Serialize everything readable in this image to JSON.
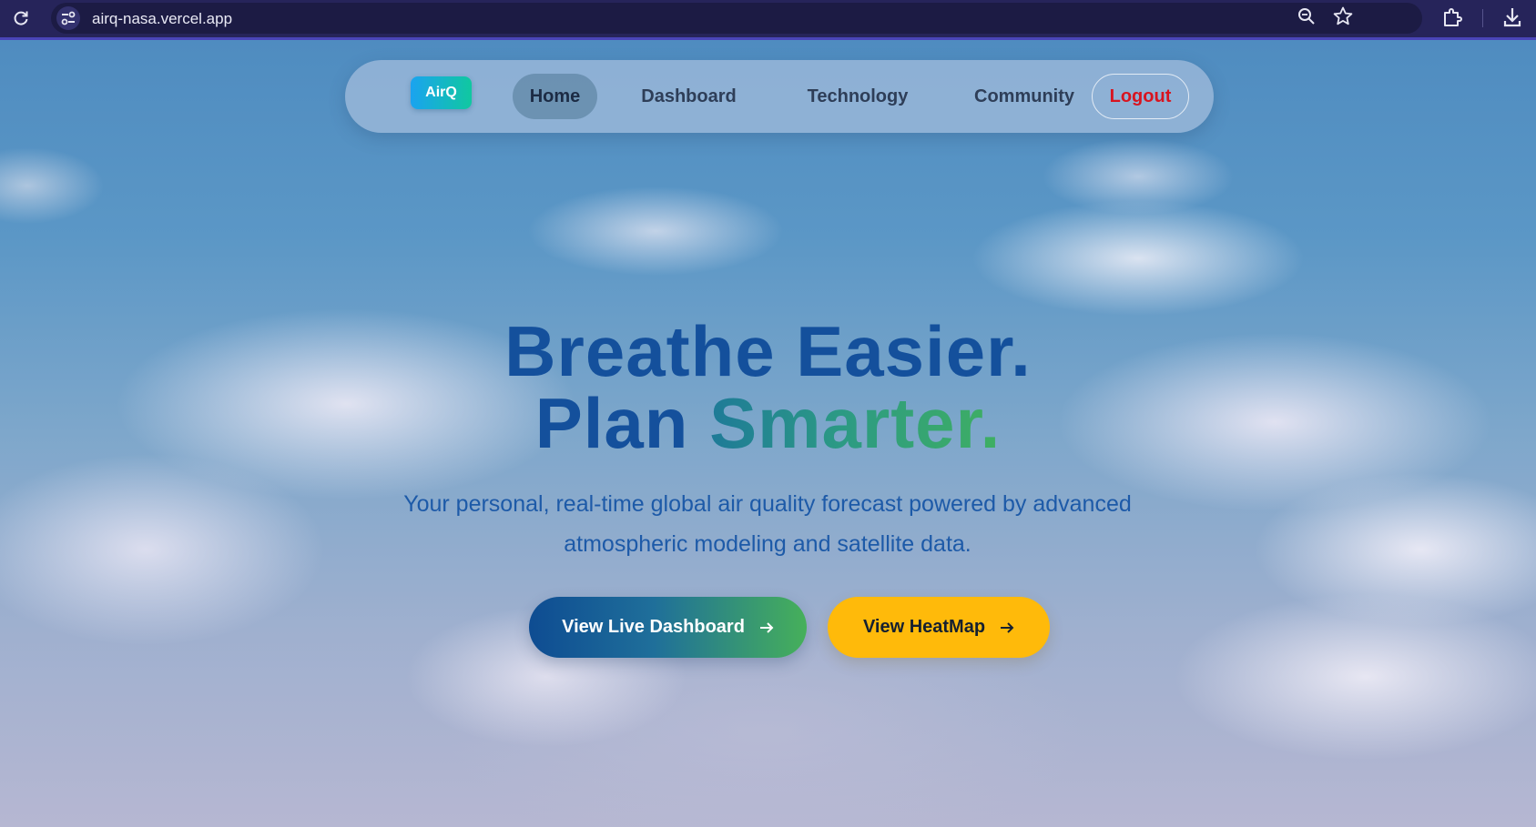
{
  "browser": {
    "url": "airq-nasa.vercel.app",
    "icons": [
      "reload-icon",
      "site-info-icon",
      "zoom-icon",
      "bookmark-star-icon",
      "extensions-icon",
      "download-icon"
    ]
  },
  "nav": {
    "logo": "AirQ",
    "items": [
      {
        "label": "Home",
        "active": true
      },
      {
        "label": "Dashboard"
      },
      {
        "label": "Technology"
      },
      {
        "label": "Community"
      }
    ],
    "logout": "Logout"
  },
  "hero": {
    "line1": "Breathe Easier.",
    "line2_part1": "Plan",
    "line2_part2": "Smarter.",
    "subtitle": "Your personal, real-time global air quality forecast powered by advanced atmospheric modeling and satellite data."
  },
  "buttons": {
    "dashboard": "View Live Dashboard",
    "heatmap": "View HeatMap"
  },
  "colors": {
    "heading": "#14509c",
    "accent_green": "#46b05a",
    "heatmap_button": "#ffba0a",
    "logout": "#d8141f"
  }
}
